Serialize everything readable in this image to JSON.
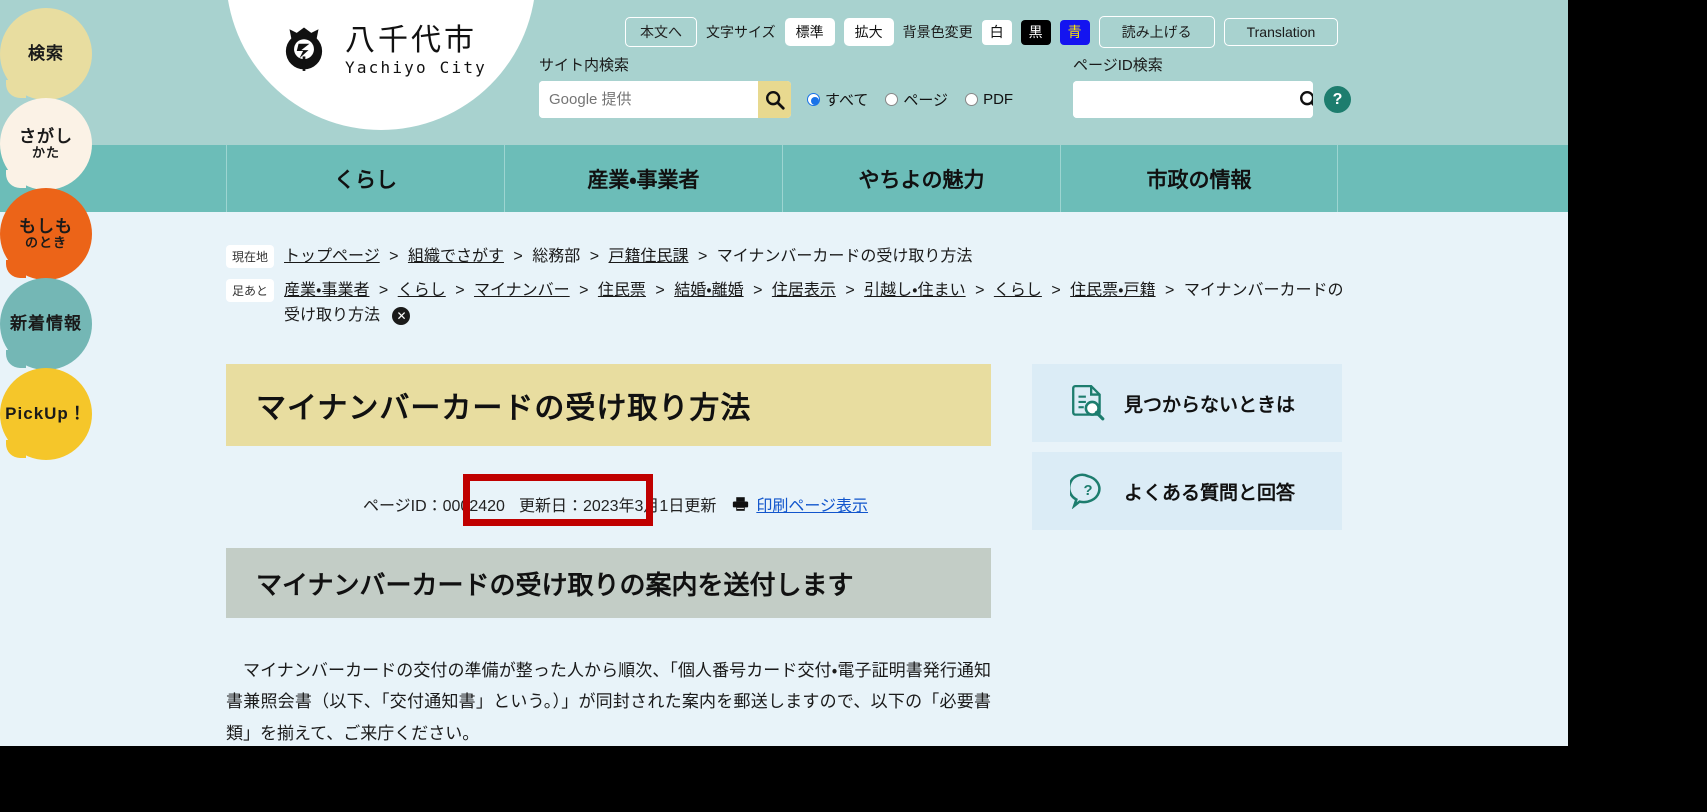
{
  "site": {
    "logo_jp": "八千代市",
    "logo_en": "Yachiyo City",
    "logo_icon": "yachiyo-city-crest-icon"
  },
  "utility_bar": {
    "skip_to_main": "本文へ",
    "font_size_label": "文字サイズ",
    "font_size_normal": "標準",
    "font_size_large": "拡大",
    "bg_color_label": "背景色変更",
    "bg_white": "白",
    "bg_black": "黒",
    "bg_blue": "青",
    "read_aloud": "読み上げる",
    "translation": "Translation"
  },
  "site_search": {
    "title": "サイト内検索",
    "placeholder": "Google 提供",
    "value": "",
    "submit_icon": "search-icon",
    "radios": [
      {
        "label": "すべて",
        "selected": true
      },
      {
        "label": "ページ",
        "selected": false
      },
      {
        "label": "PDF",
        "selected": false
      }
    ]
  },
  "page_id_search": {
    "title": "ページID検索",
    "placeholder": "",
    "value": "",
    "submit_icon": "search-icon",
    "help_label": "?"
  },
  "side_tabs": [
    {
      "line1": "検索",
      "line2": "",
      "color": "#e8dda0"
    },
    {
      "line1": "さがし",
      "line2": "かた",
      "color": "#fbf2e6"
    },
    {
      "line1": "もしも",
      "line2": "のとき",
      "color": "#ec6418"
    },
    {
      "line1": "新着情報",
      "line2": "",
      "color": "#74b7b5"
    },
    {
      "line1": "PickUp！",
      "line2": "",
      "color": "#f5c62a"
    }
  ],
  "global_nav": [
    {
      "label": "くらし"
    },
    {
      "label": "産業・事業者"
    },
    {
      "label": "やちよの魅力"
    },
    {
      "label": "市政の情報"
    }
  ],
  "breadcrumbs": {
    "current_tag": "現在地",
    "current_items": [
      {
        "label": "トップページ",
        "link": true
      },
      {
        "label": "組織でさがす",
        "link": true
      },
      {
        "label": "総務部",
        "link": false
      },
      {
        "label": "戸籍住民課",
        "link": true
      },
      {
        "label": "マイナンバーカードの受け取り方法",
        "link": false
      }
    ],
    "history_tag": "足あと",
    "history_items": [
      {
        "label": "産業・事業者",
        "link": true
      },
      {
        "label": "くらし",
        "link": true
      },
      {
        "label": "マイナンバー",
        "link": true
      },
      {
        "label": "住民票",
        "link": true
      },
      {
        "label": "結婚・離婚",
        "link": true
      },
      {
        "label": "住居表示",
        "link": true
      },
      {
        "label": "引越し・住まい",
        "link": true
      },
      {
        "label": "くらし",
        "link": true
      },
      {
        "label": "住民票・戸籍",
        "link": true
      },
      {
        "label": "マイナンバーカードの受け取り方法",
        "link": false
      }
    ],
    "clear_icon": "close-circle-icon",
    "separator": "＞"
  },
  "main": {
    "page_title": "マイナンバーカードの受け取り方法",
    "page_id_label": "ページID：0002420",
    "updated_label": "更新日：2023年3月1日更新",
    "print_icon": "printer-icon",
    "print_label": "印刷ページ表示",
    "section_heading": "マイナンバーカードの受け取りの案内を送付します",
    "body_paragraph": "マイナンバーカードの交付の準備が整った人から順次、「個人番号カード交付・電子証明書発行通知書兼照会書（以下、「交付通知書」という。）」が同封された案内を郵送しますので、以下の「必要書類」を揃えて、ご来庁ください。"
  },
  "right_rail": [
    {
      "icon": "document-search-icon",
      "label": "見つからないときは"
    },
    {
      "icon": "question-balloon-icon",
      "label": "よくある質問と回答"
    }
  ],
  "colors": {
    "header_bg": "#a8d2cf",
    "nav_bg": "#6cbdb8",
    "title_bg": "#e8dda0",
    "section_bg": "#c3cdc6",
    "rail_bg": "#dbecf6",
    "accent_green": "#1d7d6e",
    "annotation_red": "#c00000",
    "link_blue": "#1155cc"
  }
}
